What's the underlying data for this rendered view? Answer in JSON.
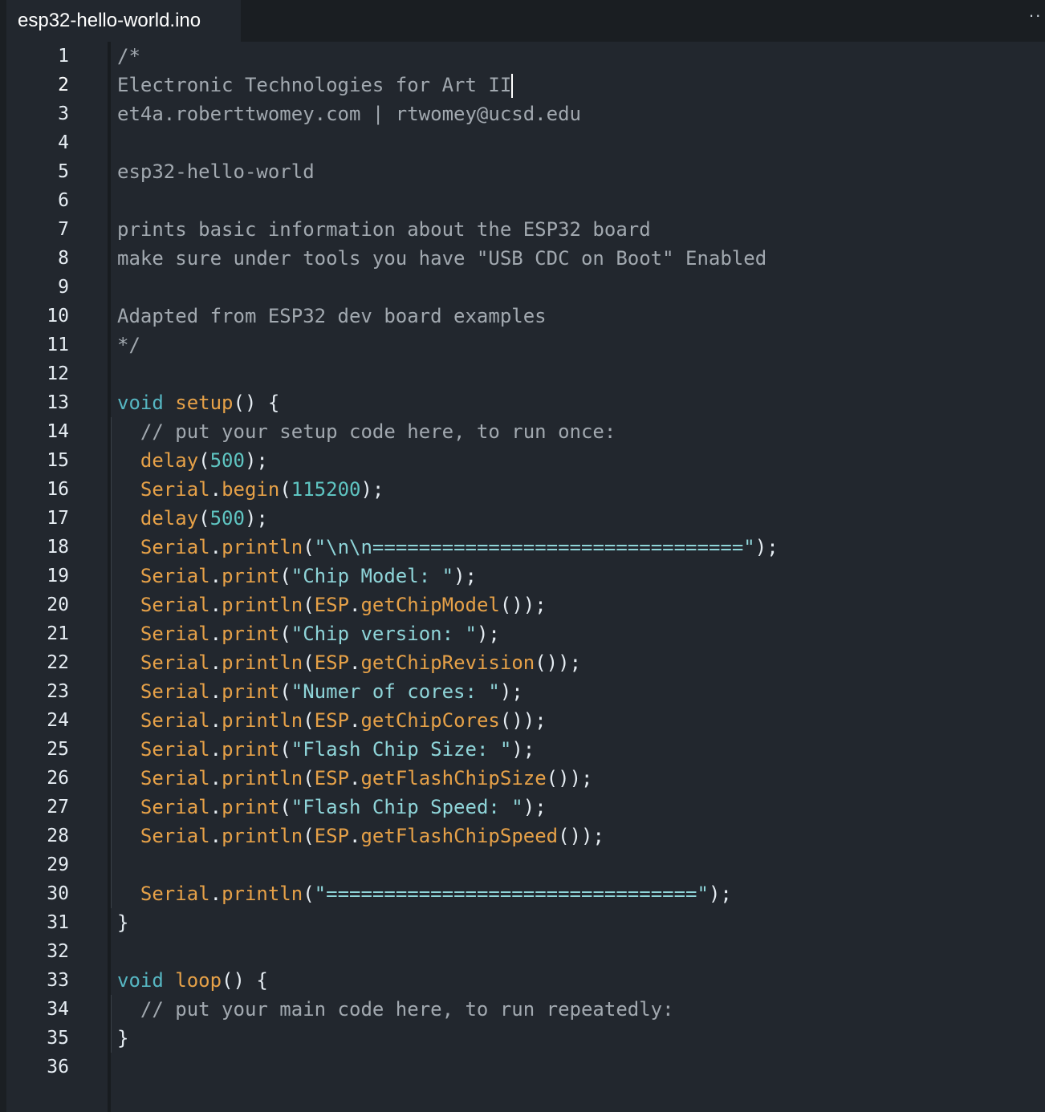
{
  "tab": {
    "filename": "esp32-hello-world.ino",
    "more_label": "··"
  },
  "editor": {
    "active_line": 2,
    "line_numbers": [
      "1",
      "2",
      "3",
      "4",
      "5",
      "6",
      "7",
      "8",
      "9",
      "10",
      "11",
      "12",
      "13",
      "14",
      "15",
      "16",
      "17",
      "18",
      "19",
      "20",
      "21",
      "22",
      "23",
      "24",
      "25",
      "26",
      "27",
      "28",
      "29",
      "30",
      "31",
      "32",
      "33",
      "34",
      "35",
      "36"
    ],
    "lines": [
      [
        {
          "t": "c",
          "v": "/*"
        }
      ],
      [
        {
          "t": "c",
          "v": "Electronic Technologies for Art II"
        },
        {
          "t": "caret",
          "v": ""
        }
      ],
      [
        {
          "t": "c",
          "v": "et4a.roberttwomey.com | rtwomey@ucsd.edu"
        }
      ],
      [],
      [
        {
          "t": "c",
          "v": "esp32-hello-world"
        }
      ],
      [],
      [
        {
          "t": "c",
          "v": "prints basic information about the ESP32 board"
        }
      ],
      [
        {
          "t": "c",
          "v": "make sure under tools you have \"USB CDC on Boot\" Enabled"
        }
      ],
      [],
      [
        {
          "t": "c",
          "v": "Adapted from ESP32 dev board examples"
        }
      ],
      [
        {
          "t": "c",
          "v": "*/"
        }
      ],
      [],
      [
        {
          "t": "k",
          "v": "void"
        },
        {
          "t": "p",
          "v": " "
        },
        {
          "t": "f",
          "v": "setup"
        },
        {
          "t": "p",
          "v": "() {"
        }
      ],
      [
        {
          "t": "p",
          "v": "  "
        },
        {
          "t": "c",
          "v": "// put your setup code here, to run once:"
        }
      ],
      [
        {
          "t": "p",
          "v": "  "
        },
        {
          "t": "f",
          "v": "delay"
        },
        {
          "t": "p",
          "v": "("
        },
        {
          "t": "n",
          "v": "500"
        },
        {
          "t": "p",
          "v": ");"
        }
      ],
      [
        {
          "t": "p",
          "v": "  "
        },
        {
          "t": "f",
          "v": "Serial"
        },
        {
          "t": "p",
          "v": "."
        },
        {
          "t": "f",
          "v": "begin"
        },
        {
          "t": "p",
          "v": "("
        },
        {
          "t": "n",
          "v": "115200"
        },
        {
          "t": "p",
          "v": ");"
        }
      ],
      [
        {
          "t": "p",
          "v": "  "
        },
        {
          "t": "f",
          "v": "delay"
        },
        {
          "t": "p",
          "v": "("
        },
        {
          "t": "n",
          "v": "500"
        },
        {
          "t": "p",
          "v": ");"
        }
      ],
      [
        {
          "t": "p",
          "v": "  "
        },
        {
          "t": "f",
          "v": "Serial"
        },
        {
          "t": "p",
          "v": "."
        },
        {
          "t": "f",
          "v": "println"
        },
        {
          "t": "p",
          "v": "("
        },
        {
          "t": "s",
          "v": "\"\\n\\n================================\""
        },
        {
          "t": "p",
          "v": ");"
        }
      ],
      [
        {
          "t": "p",
          "v": "  "
        },
        {
          "t": "f",
          "v": "Serial"
        },
        {
          "t": "p",
          "v": "."
        },
        {
          "t": "f",
          "v": "print"
        },
        {
          "t": "p",
          "v": "("
        },
        {
          "t": "s",
          "v": "\"Chip Model: \""
        },
        {
          "t": "p",
          "v": ");"
        }
      ],
      [
        {
          "t": "p",
          "v": "  "
        },
        {
          "t": "f",
          "v": "Serial"
        },
        {
          "t": "p",
          "v": "."
        },
        {
          "t": "f",
          "v": "println"
        },
        {
          "t": "p",
          "v": "("
        },
        {
          "t": "f",
          "v": "ESP"
        },
        {
          "t": "p",
          "v": "."
        },
        {
          "t": "f",
          "v": "getChipModel"
        },
        {
          "t": "p",
          "v": "());"
        }
      ],
      [
        {
          "t": "p",
          "v": "  "
        },
        {
          "t": "f",
          "v": "Serial"
        },
        {
          "t": "p",
          "v": "."
        },
        {
          "t": "f",
          "v": "print"
        },
        {
          "t": "p",
          "v": "("
        },
        {
          "t": "s",
          "v": "\"Chip version: \""
        },
        {
          "t": "p",
          "v": ");"
        }
      ],
      [
        {
          "t": "p",
          "v": "  "
        },
        {
          "t": "f",
          "v": "Serial"
        },
        {
          "t": "p",
          "v": "."
        },
        {
          "t": "f",
          "v": "println"
        },
        {
          "t": "p",
          "v": "("
        },
        {
          "t": "f",
          "v": "ESP"
        },
        {
          "t": "p",
          "v": "."
        },
        {
          "t": "f",
          "v": "getChipRevision"
        },
        {
          "t": "p",
          "v": "());"
        }
      ],
      [
        {
          "t": "p",
          "v": "  "
        },
        {
          "t": "f",
          "v": "Serial"
        },
        {
          "t": "p",
          "v": "."
        },
        {
          "t": "f",
          "v": "print"
        },
        {
          "t": "p",
          "v": "("
        },
        {
          "t": "s",
          "v": "\"Numer of cores: \""
        },
        {
          "t": "p",
          "v": ");"
        }
      ],
      [
        {
          "t": "p",
          "v": "  "
        },
        {
          "t": "f",
          "v": "Serial"
        },
        {
          "t": "p",
          "v": "."
        },
        {
          "t": "f",
          "v": "println"
        },
        {
          "t": "p",
          "v": "("
        },
        {
          "t": "f",
          "v": "ESP"
        },
        {
          "t": "p",
          "v": "."
        },
        {
          "t": "f",
          "v": "getChipCores"
        },
        {
          "t": "p",
          "v": "());"
        }
      ],
      [
        {
          "t": "p",
          "v": "  "
        },
        {
          "t": "f",
          "v": "Serial"
        },
        {
          "t": "p",
          "v": "."
        },
        {
          "t": "f",
          "v": "print"
        },
        {
          "t": "p",
          "v": "("
        },
        {
          "t": "s",
          "v": "\"Flash Chip Size: \""
        },
        {
          "t": "p",
          "v": ");"
        }
      ],
      [
        {
          "t": "p",
          "v": "  "
        },
        {
          "t": "f",
          "v": "Serial"
        },
        {
          "t": "p",
          "v": "."
        },
        {
          "t": "f",
          "v": "println"
        },
        {
          "t": "p",
          "v": "("
        },
        {
          "t": "f",
          "v": "ESP"
        },
        {
          "t": "p",
          "v": "."
        },
        {
          "t": "f",
          "v": "getFlashChipSize"
        },
        {
          "t": "p",
          "v": "());"
        }
      ],
      [
        {
          "t": "p",
          "v": "  "
        },
        {
          "t": "f",
          "v": "Serial"
        },
        {
          "t": "p",
          "v": "."
        },
        {
          "t": "f",
          "v": "print"
        },
        {
          "t": "p",
          "v": "("
        },
        {
          "t": "s",
          "v": "\"Flash Chip Speed: \""
        },
        {
          "t": "p",
          "v": ");"
        }
      ],
      [
        {
          "t": "p",
          "v": "  "
        },
        {
          "t": "f",
          "v": "Serial"
        },
        {
          "t": "p",
          "v": "."
        },
        {
          "t": "f",
          "v": "println"
        },
        {
          "t": "p",
          "v": "("
        },
        {
          "t": "f",
          "v": "ESP"
        },
        {
          "t": "p",
          "v": "."
        },
        {
          "t": "f",
          "v": "getFlashChipSpeed"
        },
        {
          "t": "p",
          "v": "());"
        }
      ],
      [],
      [
        {
          "t": "p",
          "v": "  "
        },
        {
          "t": "f",
          "v": "Serial"
        },
        {
          "t": "p",
          "v": "."
        },
        {
          "t": "f",
          "v": "println"
        },
        {
          "t": "p",
          "v": "("
        },
        {
          "t": "s",
          "v": "\"================================\""
        },
        {
          "t": "p",
          "v": ");"
        }
      ],
      [
        {
          "t": "p",
          "v": "}"
        }
      ],
      [],
      [
        {
          "t": "k",
          "v": "void"
        },
        {
          "t": "p",
          "v": " "
        },
        {
          "t": "f",
          "v": "loop"
        },
        {
          "t": "p",
          "v": "() {"
        }
      ],
      [
        {
          "t": "p",
          "v": "  "
        },
        {
          "t": "c",
          "v": "// put your main code here, to run repeatedly:"
        }
      ],
      [
        {
          "t": "p",
          "v": "}"
        }
      ],
      []
    ]
  },
  "colors": {
    "background": "#22272e",
    "comment": "#a2a9b0",
    "keyword": "#56b6c2",
    "function": "#e6a148",
    "number": "#5fc5c2",
    "string": "#8fd5d9",
    "punctuation": "#e6edf3"
  }
}
